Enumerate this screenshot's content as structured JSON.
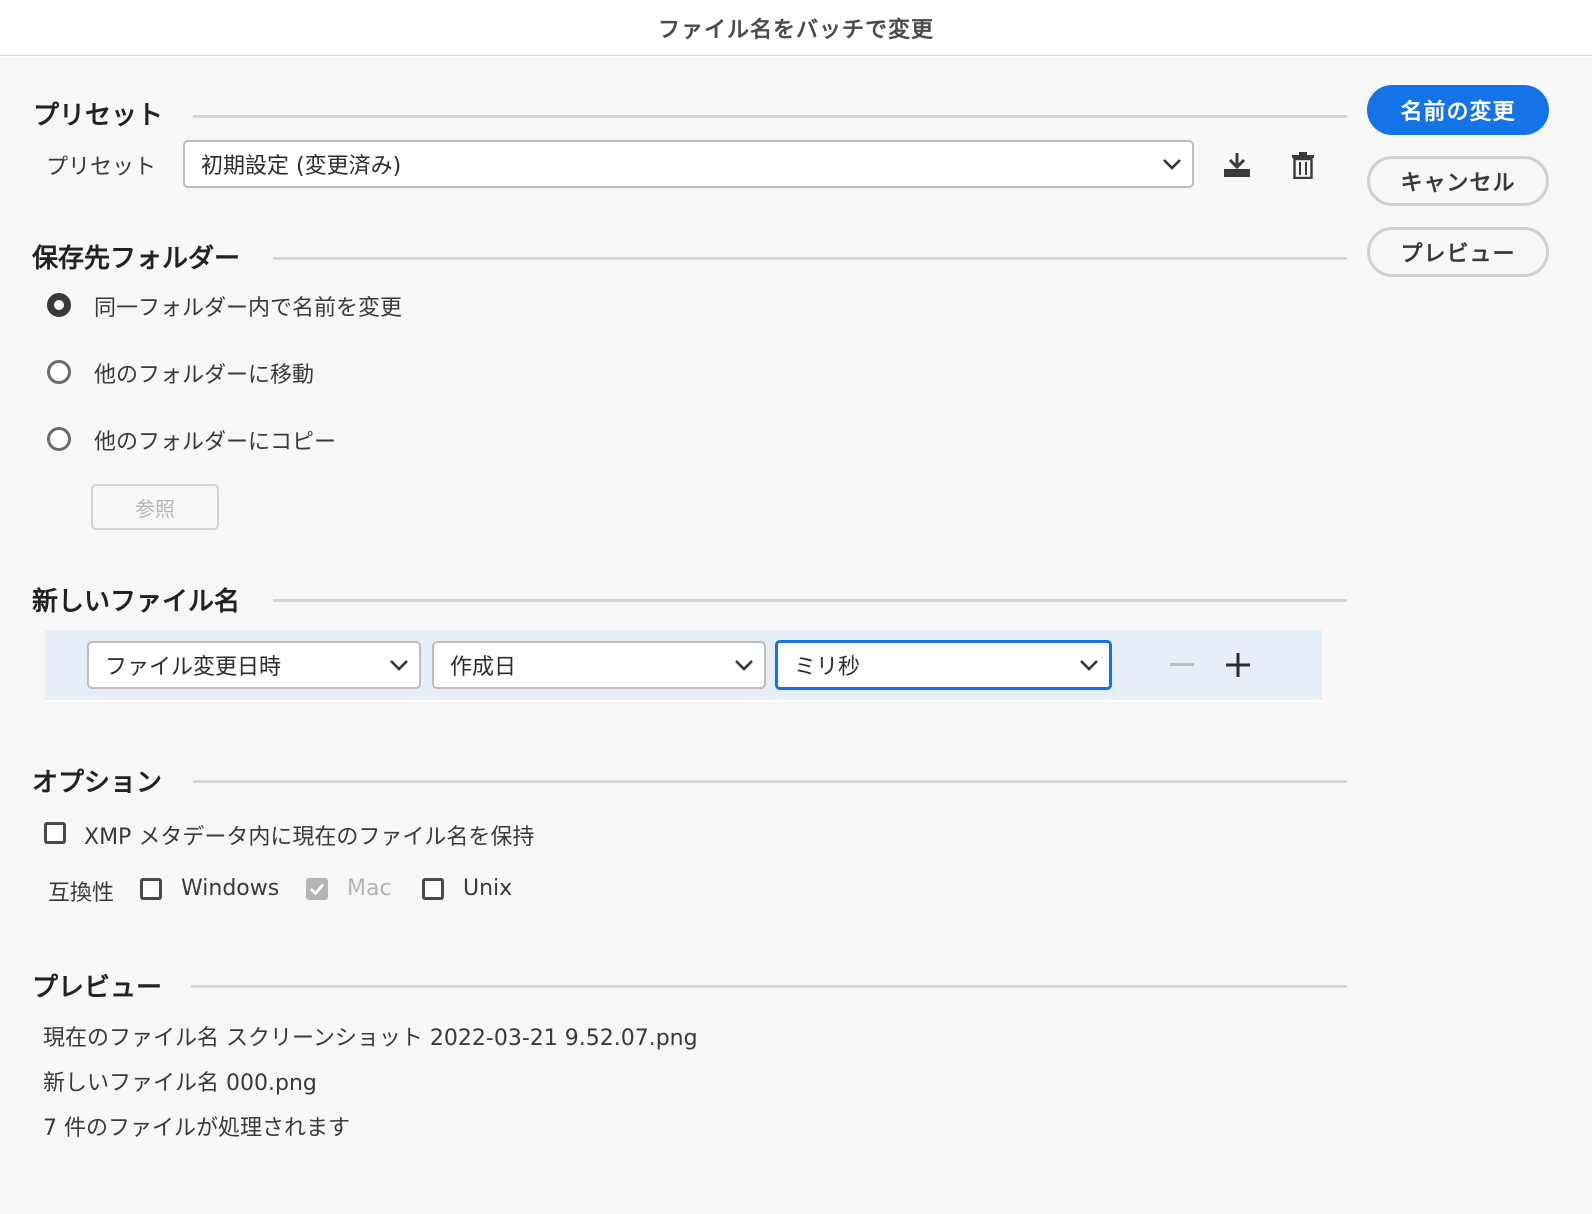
{
  "window": {
    "title": "ファイル名をバッチで変更"
  },
  "actions": {
    "rename_label": "名前の変更",
    "cancel_label": "キャンセル",
    "preview_label": "プレビュー"
  },
  "preset": {
    "section_title": "プリセット",
    "field_label": "プリセット",
    "selected": "初期設定 (変更済み)",
    "save_icon": "download-icon",
    "delete_icon": "trash-icon"
  },
  "destination": {
    "section_title": "保存先フォルダー",
    "options": [
      {
        "label": "同一フォルダー内で名前を変更",
        "checked": true
      },
      {
        "label": "他のフォルダーに移動",
        "checked": false
      },
      {
        "label": "他のフォルダーにコピー",
        "checked": false
      }
    ],
    "browse_label": "参照"
  },
  "new_filename": {
    "section_title": "新しいファイル名",
    "row": {
      "type": "ファイル変更日時",
      "date_type": "作成日",
      "format": "ミリ秒"
    }
  },
  "options": {
    "section_title": "オプション",
    "keep_xmp_label": "XMP メタデータ内に現在のファイル名を保持",
    "keep_xmp_checked": false,
    "compat_label": "互換性",
    "compat": [
      {
        "label": "Windows",
        "checked": false,
        "disabled": false
      },
      {
        "label": "Mac",
        "checked": true,
        "disabled": true
      },
      {
        "label": "Unix",
        "checked": false,
        "disabled": false
      }
    ]
  },
  "preview": {
    "section_title": "プレビュー",
    "current_label": "現在のファイル名",
    "current_value": "スクリーンショット 2022-03-21 9.52.07.png",
    "new_label": "新しいファイル名",
    "new_value": "000.png",
    "count_text": "7 件のファイルが処理されます"
  },
  "colors": {
    "accent": "#1473e6",
    "row_highlight": "#e6eef8",
    "background": "#f7f7f7"
  }
}
